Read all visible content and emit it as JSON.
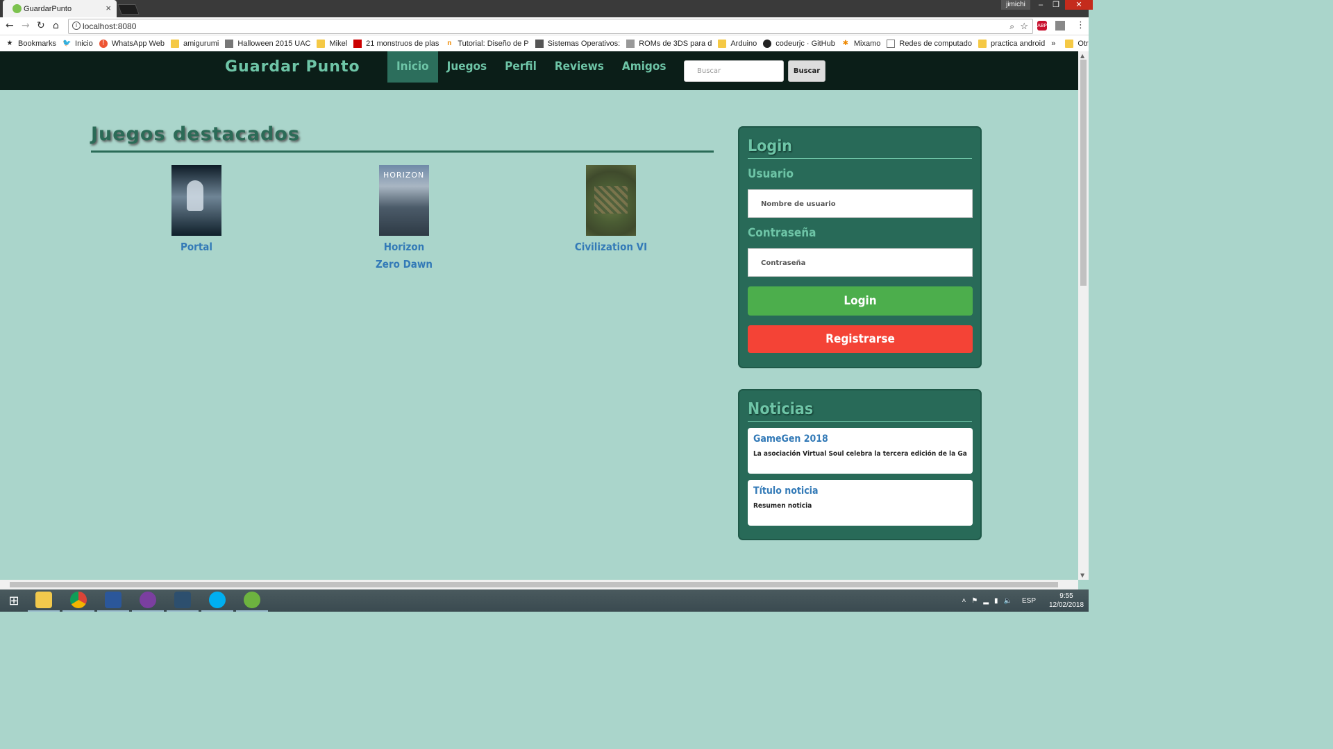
{
  "browser": {
    "tab_title": "GuardarPunto",
    "tab_close": "×",
    "user": "jimichi",
    "url": "localhost:8080",
    "bookmarks": [
      {
        "label": "Bookmarks",
        "icon": "star-icon"
      },
      {
        "label": "Inicio",
        "icon": "twitter-icon"
      },
      {
        "label": "WhatsApp Web",
        "icon": "whatsapp-icon"
      },
      {
        "label": "amigurumi",
        "icon": "folder-icon"
      },
      {
        "label": "Halloween 2015 UAC",
        "icon": "page-icon"
      },
      {
        "label": "Mikel",
        "icon": "folder-icon"
      },
      {
        "label": "21 monstruos de plas",
        "icon": "page-icon"
      },
      {
        "label": "Tutorial: Diseño de P",
        "icon": "page-icon"
      },
      {
        "label": "Sistemas Operativos:",
        "icon": "page-icon"
      },
      {
        "label": "ROMs de 3DS para d",
        "icon": "page-icon"
      },
      {
        "label": "Arduino",
        "icon": "folder-icon"
      },
      {
        "label": "codeurjc · GitHub",
        "icon": "github-icon"
      },
      {
        "label": "Mixamo",
        "icon": "mixamo-icon"
      },
      {
        "label": "Redes de computado",
        "icon": "page-icon"
      },
      {
        "label": "practica android",
        "icon": "folder-icon"
      }
    ],
    "more": "»",
    "other_bookmarks": "Otros marcadores",
    "ext_abp": "ABP"
  },
  "nav": {
    "brand": "Guardar Punto",
    "links": [
      "Inicio",
      "Juegos",
      "Perfil",
      "Reviews",
      "Amigos"
    ],
    "search_placeholder": "Buscar",
    "search_button": "Buscar"
  },
  "main": {
    "title": "Juegos destacados",
    "games": [
      {
        "title": "Portal"
      },
      {
        "title": "Horizon Zero Dawn",
        "cover_text": "HORIZON"
      },
      {
        "title": "Civilization VI"
      }
    ]
  },
  "login": {
    "title": "Login",
    "user_label": "Usuario",
    "user_placeholder": "Nombre de usuario",
    "pass_label": "Contraseña",
    "pass_placeholder": "Contraseña",
    "login_button": "Login",
    "register_button": "Registrarse"
  },
  "news": {
    "title": "Noticias",
    "items": [
      {
        "title": "GameGen 2018",
        "summary": "La asociación Virtual Soul celebra la tercera edición de la GameGen."
      },
      {
        "title": "Título noticia",
        "summary": "Resumen noticia"
      }
    ]
  },
  "taskbar": {
    "lang": "ESP",
    "time": "9:55",
    "date": "12/02/2018"
  },
  "colors": {
    "page_bg": "#aad5cb",
    "nav_bg": "#0b1e18",
    "accent": "#6ec5a7",
    "panel_bg": "#286a58",
    "link": "#337ab7",
    "login_green": "#4cae4c",
    "register_red": "#f44336"
  }
}
